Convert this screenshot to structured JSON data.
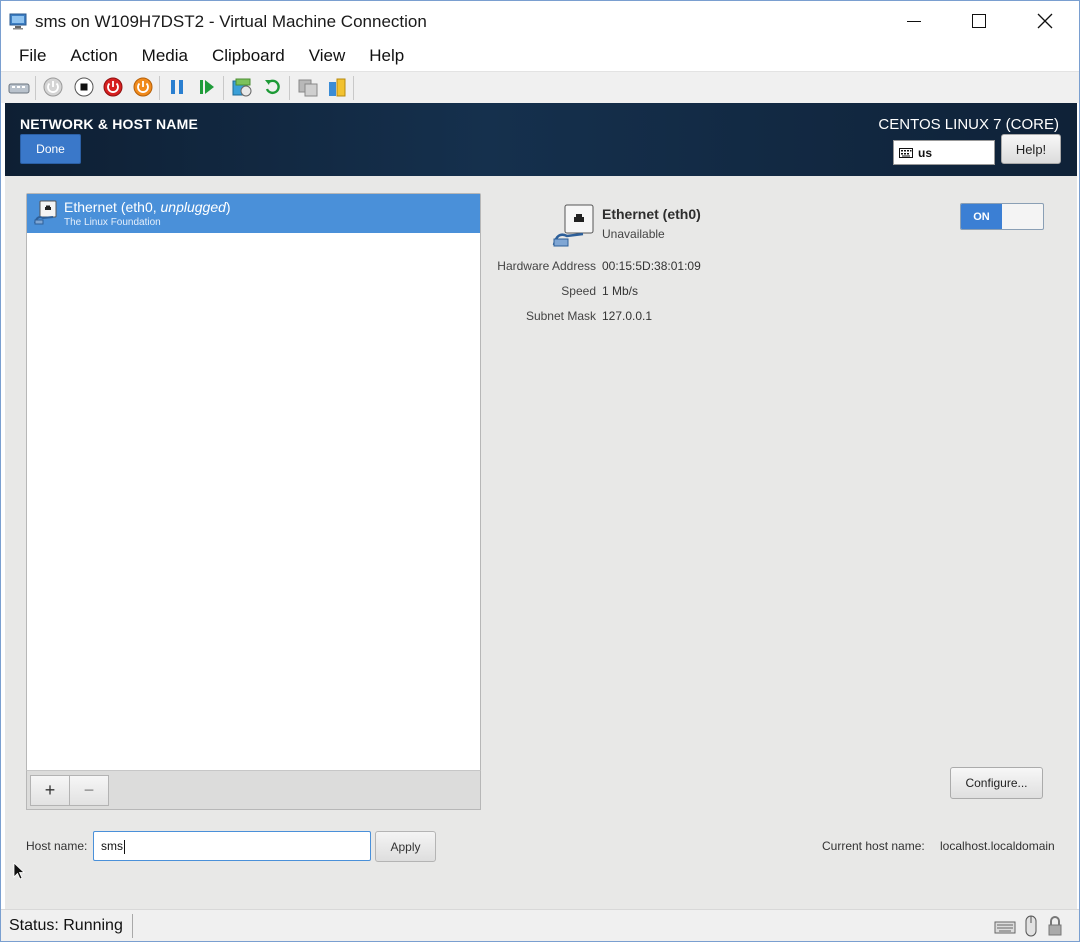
{
  "window": {
    "title": "sms on W109H7DST2 - Virtual Machine Connection",
    "controls": {
      "minimize": "—",
      "maximize": "☐",
      "close": "✕"
    }
  },
  "menubar": {
    "items": [
      "File",
      "Action",
      "Media",
      "Clipboard",
      "View",
      "Help"
    ]
  },
  "toolbar": {
    "icons": [
      "ctrl-alt-del-icon",
      "start-icon",
      "turn-off-icon",
      "shut-down-icon",
      "power-icon",
      "pause-icon",
      "resume-icon",
      "checkpoint-icon",
      "revert-icon",
      "enhanced-session-icon",
      "share-icon"
    ]
  },
  "vm": {
    "header": {
      "title": "NETWORK & HOST NAME",
      "done_label": "Done",
      "os_name": "CENTOS LINUX 7 (CORE)",
      "keyboard_layout": "us",
      "help_label": "Help!"
    },
    "device_list": {
      "items": [
        {
          "name_prefix": "Ethernet (eth0, ",
          "name_state": "unplugged",
          "name_suffix": ")",
          "vendor": "The Linux Foundation"
        }
      ],
      "add_label": "+",
      "remove_label": "−"
    },
    "device_detail": {
      "name": "Ethernet (eth0)",
      "state": "Unavailable",
      "toggle_label": "ON",
      "properties": [
        {
          "label": "Hardware Address",
          "value": "00:15:5D:38:01:09"
        },
        {
          "label": "Speed",
          "value": "1 Mb/s"
        },
        {
          "label": "Subnet Mask",
          "value": "127.0.0.1"
        }
      ],
      "configure_label": "Configure..."
    },
    "hostname": {
      "label": "Host name:",
      "value": "sms",
      "apply_label": "Apply",
      "current_label": "Current host name:",
      "current_value": "localhost.localdomain"
    }
  },
  "statusbar": {
    "text": "Status: Running"
  },
  "colors": {
    "accent": "#4a90d9",
    "header_bg": "#15304d",
    "toggle_on": "#3b7fd4"
  }
}
